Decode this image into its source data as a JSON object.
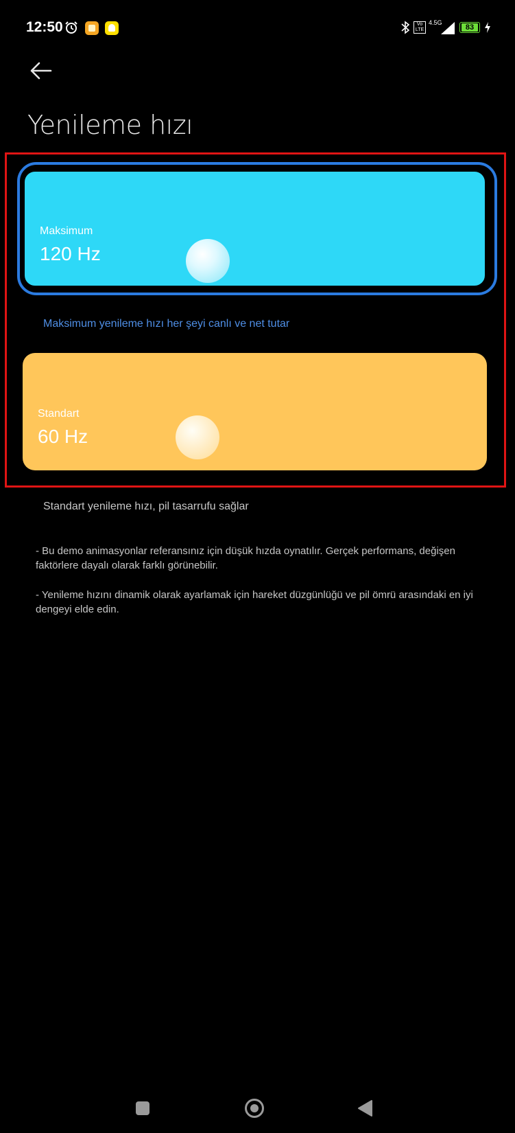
{
  "status_bar": {
    "time": "12:50",
    "network": "4.5G",
    "volte": "Vo LTE",
    "battery": "83",
    "icons": [
      "alarm-icon",
      "app-icon",
      "snapchat-icon",
      "bluetooth-icon",
      "volte-icon",
      "signal-icon",
      "battery-icon",
      "charging-icon"
    ]
  },
  "header": {
    "back_icon": "back-arrow-icon",
    "title": "Yenileme hızı"
  },
  "options": [
    {
      "label": "Maksimum",
      "value": "120 Hz",
      "caption": "Maksimum yenileme hızı her şeyi canlı ve net tutar",
      "selected": true,
      "color": "#2ed8f7"
    },
    {
      "label": "Standart",
      "value": "60 Hz",
      "caption": "Standart yenileme hızı, pil tasarrufu sağlar",
      "selected": false,
      "color": "#ffc65a"
    }
  ],
  "notes": [
    "- Bu demo animasyonlar referansınız için düşük hızda oynatılır. Gerçek performans, değişen faktörlere dayalı olarak farklı görünebilir.",
    "- Yenileme hızını dinamik olarak ayarlamak için hareket düzgünlüğü ve pil ömrü arasındaki en iyi dengeyi elde edin."
  ],
  "nav_bar": {
    "icons": [
      "recents-square-icon",
      "home-circle-icon",
      "back-triangle-icon"
    ]
  },
  "colors": {
    "selection_ring": "#2b7be0",
    "highlight_frame": "#e01414",
    "selected_caption": "#4f8fe6"
  }
}
